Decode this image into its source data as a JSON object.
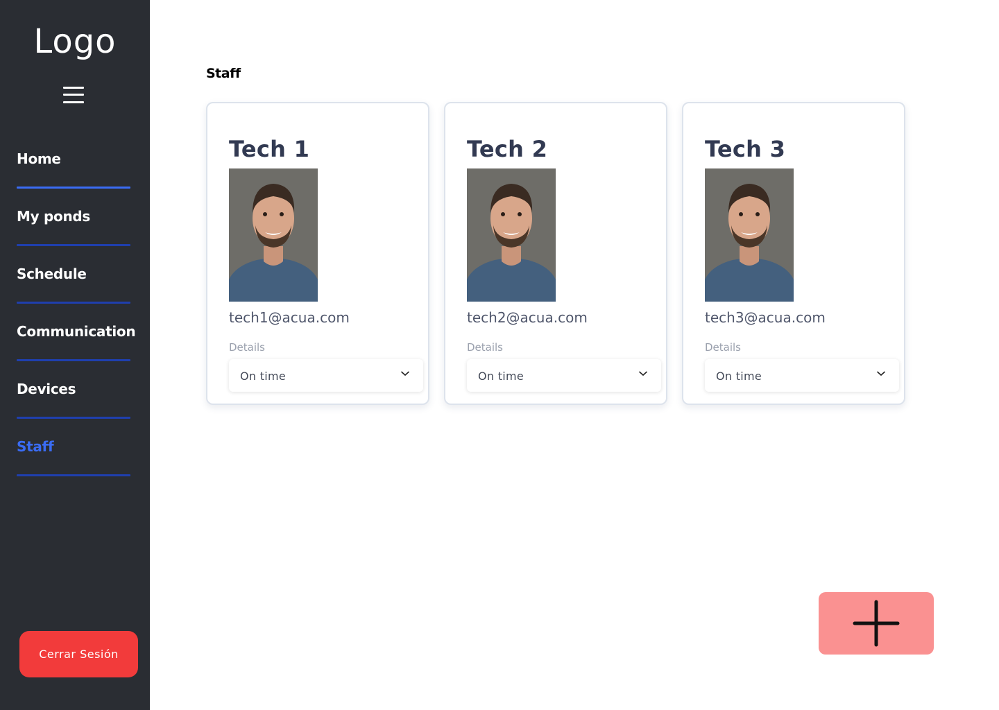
{
  "sidebar": {
    "logo": "Logo",
    "menu_icon": "hamburger-menu-icon",
    "items": [
      {
        "label": "Home",
        "active": false
      },
      {
        "label": "My ponds",
        "active": false
      },
      {
        "label": "Schedule",
        "active": false
      },
      {
        "label": "Communication",
        "active": false
      },
      {
        "label": "Devices",
        "active": false
      },
      {
        "label": "Staff",
        "active": true
      }
    ],
    "logout_label": "Cerrar Sesión"
  },
  "main": {
    "title": "Staff",
    "cards": [
      {
        "name": "Tech 1",
        "email": "tech1@acua.com",
        "details_label": "Details",
        "status": "On time"
      },
      {
        "name": "Tech 2",
        "email": "tech2@acua.com",
        "details_label": "Details",
        "status": "On time"
      },
      {
        "name": "Tech 3",
        "email": "tech3@acua.com",
        "details_label": "Details",
        "status": "On time"
      }
    ],
    "add_icon": "plus-icon"
  },
  "colors": {
    "sidebar_bg": "#2a2d33",
    "accent": "#3a6cf4",
    "logout": "#f23b3b",
    "add_button": "#fa9191"
  }
}
